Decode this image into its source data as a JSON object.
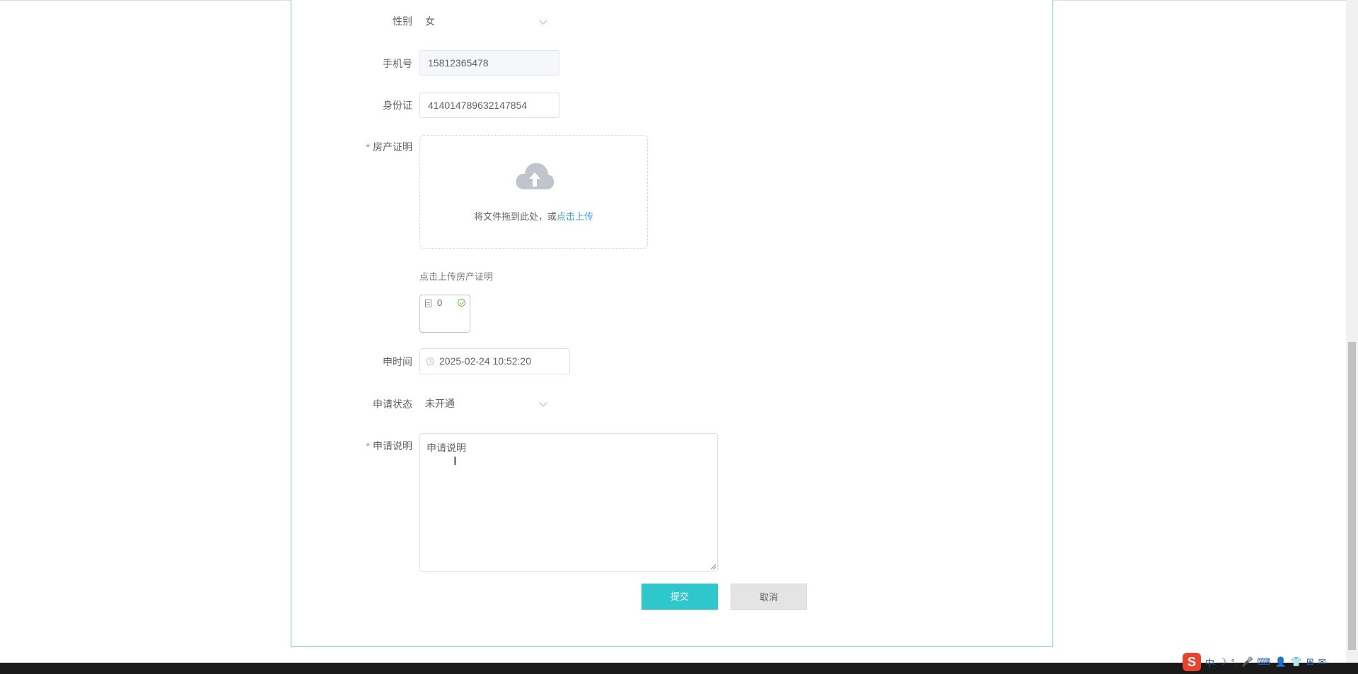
{
  "form": {
    "gender": {
      "label": "性别",
      "value": "女"
    },
    "phone": {
      "label": "手机号",
      "value": "15812365478"
    },
    "id_card": {
      "label": "身份证",
      "value": "414014789632147854"
    },
    "property_proof": {
      "label": "房产证明",
      "required_mark": "*",
      "upload_text": "将文件拖到此处，或",
      "upload_link": "点击上传",
      "tip": "点击上传房产证明",
      "file_name": "0"
    },
    "apply_time": {
      "label": "申时间",
      "value": "2025-02-24 10:52:20"
    },
    "apply_status": {
      "label": "申请状态",
      "value": "未开通"
    },
    "apply_desc": {
      "label": "申请说明",
      "required_mark": "*",
      "value": "申请说明"
    }
  },
  "buttons": {
    "submit": "提交",
    "cancel": "取消"
  },
  "ime": {
    "logo": "S",
    "mode": "中",
    "items": [
      "☽",
      "°,",
      "🎤",
      "⌨",
      "👤",
      "👕",
      "⊞",
      "✉"
    ]
  },
  "colors": {
    "card_border": "#7fc8d6",
    "submit_bg": "#2ec7cc",
    "required": "#f56c6c",
    "link": "#409eff"
  }
}
